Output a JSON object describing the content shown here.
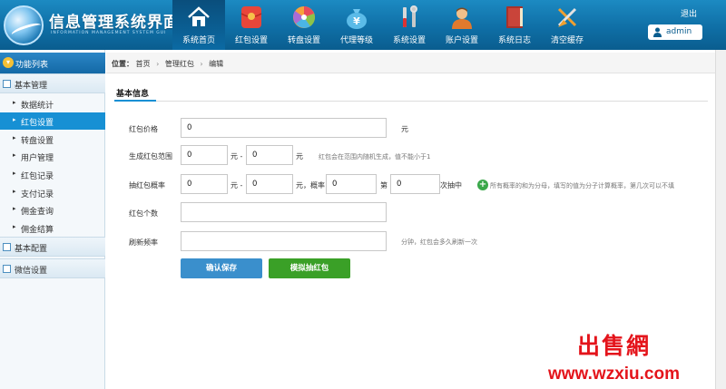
{
  "header": {
    "logo_title": "信息管理系统界面",
    "logo_subtitle": "INFORMATION MANAGEMENT SYSTEM GUI",
    "exit_label": "退出",
    "user_label": "admin",
    "nav": [
      {
        "label": "系统首页",
        "icon": "home-icon",
        "glyph": "⌂",
        "color": "#ffffff"
      },
      {
        "label": "红包设置",
        "icon": "red-envelope-icon",
        "glyph": "●",
        "color": "#f04a3c"
      },
      {
        "label": "转盘设置",
        "icon": "wheel-icon",
        "glyph": "◉",
        "color": "#f7a23b"
      },
      {
        "label": "代理等级",
        "icon": "money-bag-icon",
        "glyph": "¥",
        "color": "#4bb5e6"
      },
      {
        "label": "系统设置",
        "icon": "tools-icon",
        "glyph": "✂",
        "color": "#d8d8d8"
      },
      {
        "label": "账户设置",
        "icon": "account-icon",
        "glyph": "☻",
        "color": "#f2c08a"
      },
      {
        "label": "系统日志",
        "icon": "log-book-icon",
        "glyph": "▮",
        "color": "#c33a2a"
      },
      {
        "label": "清空缓存",
        "icon": "clear-cache-icon",
        "glyph": "✕",
        "color": "#f0a030"
      }
    ]
  },
  "sidebar": {
    "title": "功能列表",
    "groups": [
      {
        "label": "基本管理"
      },
      {
        "label": "基本配置"
      },
      {
        "label": "微信设置"
      }
    ],
    "items": [
      {
        "label": "数据统计"
      },
      {
        "label": "红包设置"
      },
      {
        "label": "转盘设置"
      },
      {
        "label": "用户管理"
      },
      {
        "label": "红包记录"
      },
      {
        "label": "支付记录"
      },
      {
        "label": "佣金查询"
      },
      {
        "label": "佣金结算"
      }
    ]
  },
  "breadcrumb": {
    "prefix": "位置：",
    "items": [
      "首页",
      "管理红包",
      "编辑"
    ],
    "separator": "›"
  },
  "section": {
    "title": "基本信息"
  },
  "form": {
    "price": {
      "label": "红包价格",
      "value": "0",
      "unit": "元"
    },
    "range": {
      "label": "生成红包范围",
      "min": "0",
      "max": "0",
      "unit_min": "元 -",
      "unit_max": "元",
      "hint": "红包会在范围内随机生成，值不能小于1"
    },
    "prob": {
      "label": "抽红包概率",
      "min": "0",
      "max": "0",
      "unit_min": "元 -",
      "unit_max": "元，概率",
      "prob": "0",
      "unit_prob": "第",
      "nth": "0",
      "unit_nth": "次抽中",
      "hint": "所有概率的和为分母，填写的值为分子计算概率，第几次可以不填"
    },
    "count": {
      "label": "红包个数",
      "value": ""
    },
    "refresh": {
      "label": "刷新频率",
      "value": "",
      "hint": "分钟，红包会多久刷新一次"
    }
  },
  "buttons": {
    "save": "确认保存",
    "simulate": "模拟抽红包"
  },
  "watermark": {
    "logo": "出售網",
    "url": "www.wzxiu.com"
  },
  "colors": {
    "header": "#0f6fa6",
    "active_item": "#1790d4",
    "save_button": "#3a8fcc",
    "simulate_button": "#3aa027",
    "watermark": "#e4141b"
  }
}
